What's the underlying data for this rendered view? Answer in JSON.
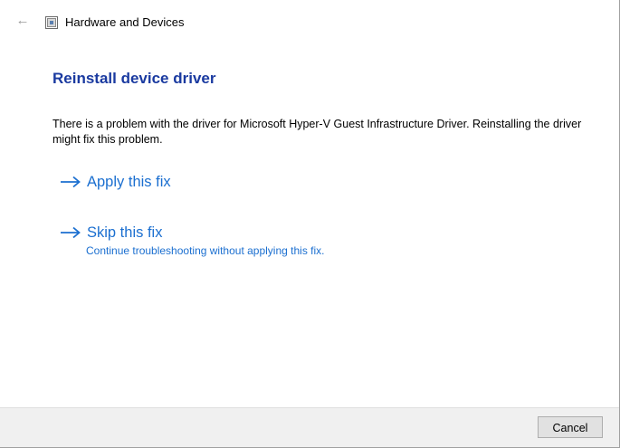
{
  "window": {
    "title": "Hardware and Devices",
    "icon": "troubleshooter-icon",
    "back_icon": "back-arrow-icon"
  },
  "main": {
    "heading": "Reinstall device driver",
    "description": "There is a problem with the driver for Microsoft Hyper-V Guest Infrastructure Driver. Reinstalling the driver might fix this problem.",
    "options": [
      {
        "label": "Apply this fix",
        "icon": "arrow-right-icon"
      },
      {
        "label": "Skip this fix",
        "sublabel": "Continue troubleshooting without applying this fix.",
        "icon": "arrow-right-icon"
      }
    ]
  },
  "footer": {
    "cancel_label": "Cancel"
  },
  "colors": {
    "heading": "#1a3aa0",
    "link": "#1b6fd0",
    "footer_bg": "#f0f0f0"
  }
}
